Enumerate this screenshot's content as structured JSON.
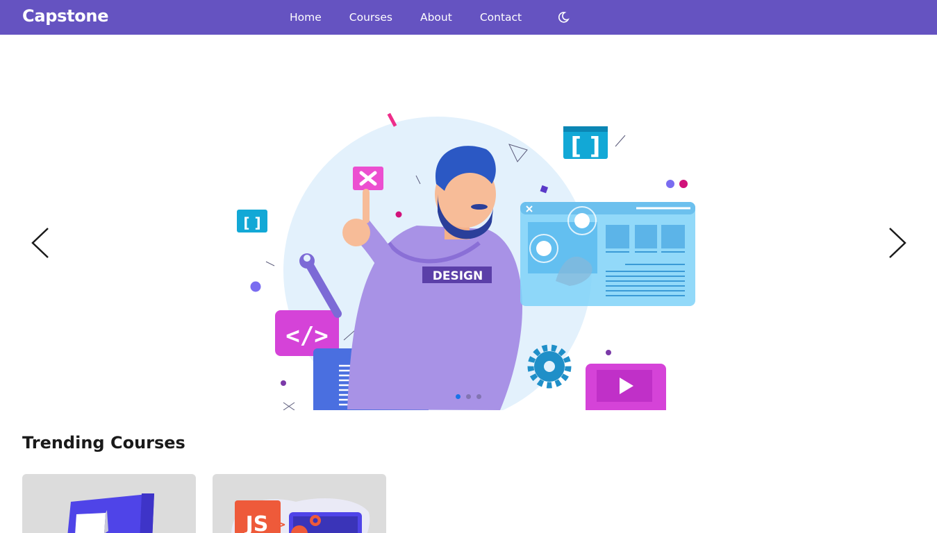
{
  "navbar": {
    "brand": "Capstone",
    "links": [
      {
        "label": "Home"
      },
      {
        "label": "Courses"
      },
      {
        "label": "About"
      },
      {
        "label": "Contact"
      }
    ],
    "theme_icon": "moon-icon"
  },
  "hero": {
    "badge_text": "DESIGN",
    "prev_icon": "chevron-left-icon",
    "next_icon": "chevron-right-icon",
    "indicator_count": 3,
    "active_indicator": 0
  },
  "trending": {
    "title": "Trending Courses",
    "cards": [
      {
        "icon": "css3-logo"
      },
      {
        "icon": "javascript-illustration",
        "label": "JS"
      }
    ]
  },
  "colors": {
    "nav_bg": "#6553c1",
    "accent_blue": "#1a73e8",
    "card_bg": "#dcdcdc"
  }
}
